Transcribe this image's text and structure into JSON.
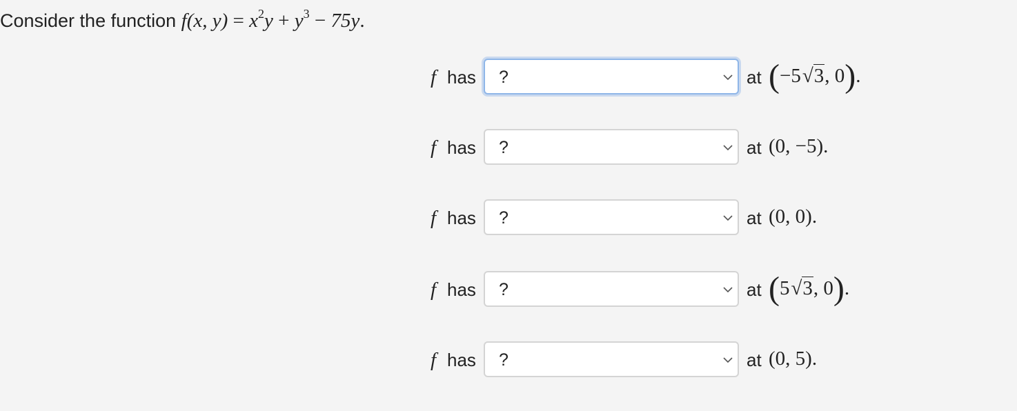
{
  "prompt": {
    "lead": "Consider the function",
    "function_name": "f",
    "args": "(x, y)",
    "equals": "=",
    "term1_base": "x",
    "term1_exp": "2",
    "term1_tail": "y",
    "plus": "+",
    "term2_base": "y",
    "term2_exp": "3",
    "minus": "−",
    "term3": "75y",
    "period": "."
  },
  "rows": [
    {
      "f": "f",
      "has": "has",
      "selected": "?",
      "at": "at",
      "point": "(−5√3, 0).",
      "point_parts": {
        "open": "(",
        "prefix": "−5",
        "radicand": "3",
        "suffix": ", 0",
        "close": ")",
        "end": "."
      }
    },
    {
      "f": "f",
      "has": "has",
      "selected": "?",
      "at": "at",
      "point": "(0, −5)."
    },
    {
      "f": "f",
      "has": "has",
      "selected": "?",
      "at": "at",
      "point": "(0, 0)."
    },
    {
      "f": "f",
      "has": "has",
      "selected": "?",
      "at": "at",
      "point": "(5√3, 0).",
      "point_parts": {
        "open": "(",
        "prefix": "5",
        "radicand": "3",
        "suffix": ", 0",
        "close": ")",
        "end": "."
      }
    },
    {
      "f": "f",
      "has": "has",
      "selected": "?",
      "at": "at",
      "point": "(0, 5)."
    }
  ]
}
